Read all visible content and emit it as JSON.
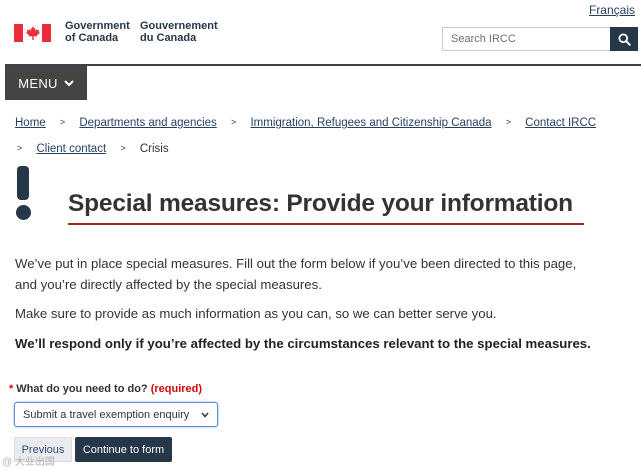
{
  "header": {
    "language_link": "Français",
    "gov_en_line1": "Government",
    "gov_en_line2": "of Canada",
    "gov_fr_line1": "Gouvernement",
    "gov_fr_line2": "du Canada",
    "search_placeholder": "Search IRCC",
    "menu_label": "MENU"
  },
  "breadcrumb": {
    "items": [
      "Home",
      "Departments and agencies",
      "Immigration, Refugees and Citizenship Canada",
      "Contact IRCC",
      "Client contact"
    ],
    "current": "Crisis",
    "separator": ">"
  },
  "main": {
    "title": "Special measures: Provide your information",
    "paragraph1_line1": "We’ve put in place special measures. Fill out the form below if you’ve been directed to this page,",
    "paragraph1_line2": "and you’re directly affected by the special measures.",
    "paragraph2": "Make sure to provide as much information as you can, so we can better serve you.",
    "paragraph3": "We’ll respond only if you’re affected by the circumstances relevant to the special measures."
  },
  "form": {
    "required_marker": "*",
    "question_label": "What do you need to do?",
    "required_text": "(required)",
    "selected_option": "Submit a travel exemption enquiry",
    "previous_button": "Previous",
    "continue_button": "Continue to form"
  },
  "watermark": "@ 大业出国",
  "colors": {
    "flag_red": "#eb2d37",
    "navy": "#26374a",
    "link": "#284162",
    "title_underline": "#a62a1e",
    "required_red": "#d3080c"
  },
  "icons": [
    "maple-leaf-icon",
    "search-icon",
    "chevron-down-icon",
    "alert-icon",
    "select-chevron-icon"
  ]
}
